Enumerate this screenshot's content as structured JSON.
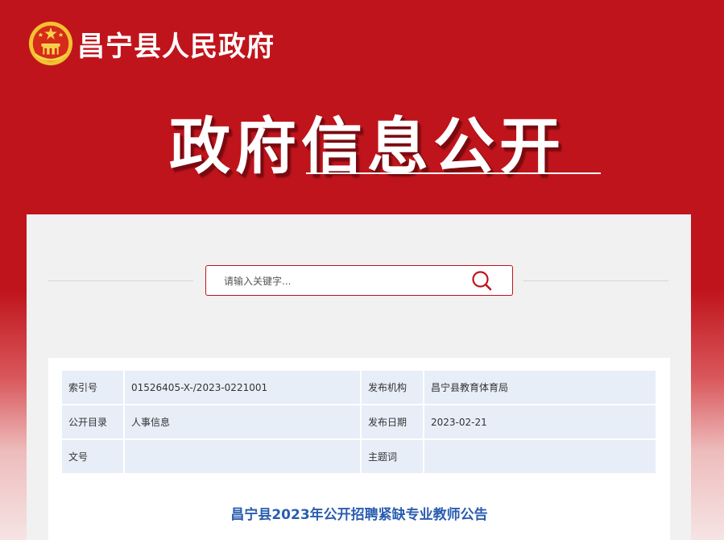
{
  "header": {
    "site_name": "昌宁县人民政府"
  },
  "banner": {
    "title": "政府信息公开"
  },
  "search": {
    "placeholder": "请输入关键字..."
  },
  "meta": {
    "rows": [
      {
        "k1": "索引号",
        "v1": "01526405-X-/2023-0221001",
        "k2": "发布机构",
        "v2": "昌宁县教育体育局"
      },
      {
        "k1": "公开目录",
        "v1": "人事信息",
        "k2": "发布日期",
        "v2": "2023-02-21"
      },
      {
        "k1": "文号",
        "v1": "",
        "k2": "主题词",
        "v2": ""
      }
    ]
  },
  "article": {
    "title": "昌宁县2023年公开招聘紧缺专业教师公告"
  },
  "colors": {
    "brand_red": "#c0141c",
    "title_blue": "#2a5db0",
    "table_bg": "#e7eef8"
  }
}
